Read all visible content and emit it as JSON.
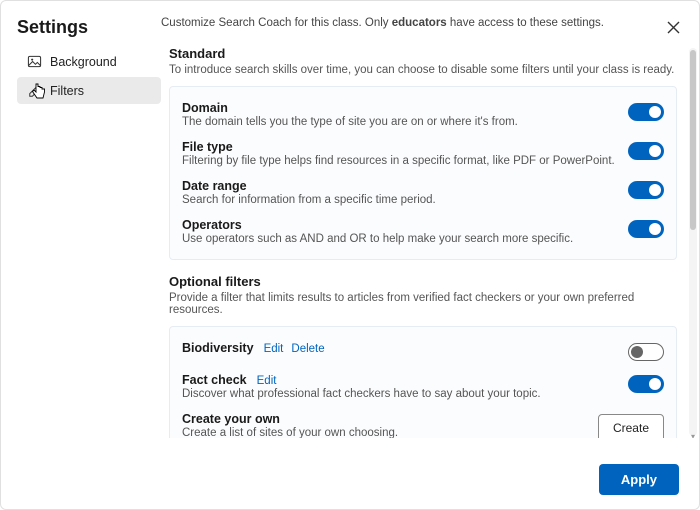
{
  "header": {
    "title": "Settings",
    "subtitle_pre": "Customize Search Coach for this class. Only ",
    "subtitle_bold": "educators",
    "subtitle_post": " have access to these settings."
  },
  "sidebar": {
    "items": [
      {
        "label": "Background",
        "icon": "image",
        "selected": false
      },
      {
        "label": "Filters",
        "icon": "pencil",
        "selected": true
      }
    ]
  },
  "sections": {
    "standard": {
      "heading": "Standard",
      "desc": "To introduce search skills over time, you can choose to disable some filters until your class is ready.",
      "items": [
        {
          "title": "Domain",
          "desc": "The domain tells you the type of site you are on or where it's from.",
          "toggle": true
        },
        {
          "title": "File type",
          "desc": "Filtering by file type helps find resources in a specific format, like PDF or PowerPoint.",
          "toggle": true
        },
        {
          "title": "Date range",
          "desc": "Search for information from a specific time period.",
          "toggle": true
        },
        {
          "title": "Operators",
          "desc": "Use operators such as AND and OR to help make your search more specific.",
          "toggle": true
        }
      ]
    },
    "optional": {
      "heading": "Optional filters",
      "desc": "Provide a filter that limits results to articles from verified fact checkers or your own preferred resources.",
      "items": [
        {
          "title": "Biodiversity",
          "desc": "",
          "links": [
            "Edit",
            "Delete"
          ],
          "toggle": false
        },
        {
          "title": "Fact check",
          "desc": "Discover what professional fact checkers have to say about your topic.",
          "links": [
            "Edit"
          ],
          "toggle": true
        },
        {
          "title": "Create your own",
          "desc": "Create a list of sites of your own choosing.",
          "create": true
        }
      ]
    }
  },
  "buttons": {
    "create": "Create",
    "apply": "Apply"
  }
}
